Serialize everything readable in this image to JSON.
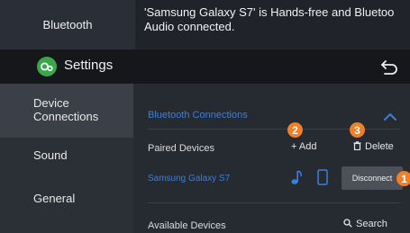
{
  "banner": {
    "left_label": "Bluetooth",
    "message_line1": "'Samsung Galaxy S7' is Hands-free and Bluetoo",
    "message_line2": "Audio connected."
  },
  "header": {
    "title": "Settings",
    "app_icon": "settings-gear-icon",
    "back_icon": "back-arrow-icon"
  },
  "sidebar": {
    "items": [
      {
        "label": "Device Connections"
      },
      {
        "label": "Sound"
      },
      {
        "label": "General"
      }
    ]
  },
  "bluetooth": {
    "section_title": "Bluetooth Connections",
    "paired_label": "Paired Devices",
    "add_label": "+ Add",
    "delete_label": "Delete",
    "device_name": "Samsung Galaxy S7",
    "disconnect_label": "Disconnect",
    "available_label": "Available Devices",
    "search_label": "Search"
  },
  "callouts": {
    "one": "1",
    "two": "2",
    "three": "3"
  },
  "colors": {
    "accent_blue": "#3c7fd6",
    "callout_orange": "#f07f2a",
    "settings_green": "#3aa84a"
  }
}
